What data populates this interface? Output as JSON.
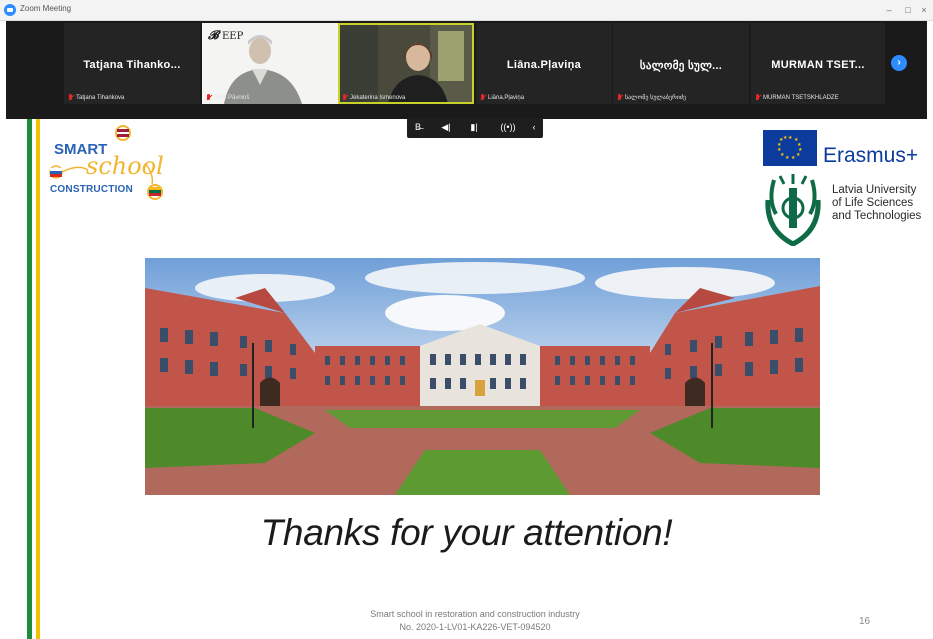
{
  "window": {
    "title": "Zoom Meeting",
    "controls": {
      "minimize": "–",
      "maximize": "□",
      "close": "×"
    }
  },
  "gallery": {
    "tiles": [
      {
        "display_name": "Tatjana Tihanko...",
        "label": "Tatjana Tihankova",
        "has_video": false
      },
      {
        "display_name": "",
        "label": "Ilmis Pāvniņš",
        "has_video": true,
        "overlay_text": "EEP"
      },
      {
        "display_name": "",
        "label": "Jekaterina Ismenova",
        "has_video": true,
        "active_speaker": true
      },
      {
        "display_name": "Liāna.Pļaviņa",
        "label": "Liāna.Pļaviņa",
        "has_video": false
      },
      {
        "display_name": "სალომე სულ...",
        "label": "სალომე სულაბერიძე",
        "has_video": false
      },
      {
        "display_name": "MURMAN TSET...",
        "label": "MURMAN TSETSKHLADZE",
        "has_video": false
      }
    ],
    "next_icon": "chevron-right-icon"
  },
  "toolbar": {
    "items": [
      {
        "icon": "annotate-icon",
        "glyph": "B͍"
      },
      {
        "icon": "volume-icon",
        "glyph": "◀︎"
      },
      {
        "icon": "microphone-icon",
        "glyph": "🎙"
      },
      {
        "icon": "broadcast-icon",
        "glyph": "((•))"
      },
      {
        "icon": "collapse-icon",
        "glyph": "‹"
      }
    ]
  },
  "slide": {
    "logo_left": {
      "line1": "SMART",
      "line2": "school",
      "line3": "CONSTRUCTION"
    },
    "erasmus_label": "Erasmus+",
    "university": {
      "line1": "Latvia University",
      "line2": "of Life Sciences",
      "line3": "and Technologies"
    },
    "thanks": "Thanks for your attention!",
    "footer": {
      "line1": "Smart school in restoration and construction industry",
      "line2": "No. 2020-1-LV01-KA226-VET-094520"
    },
    "page_number": "16",
    "colors": {
      "stripe_green": "#1e8a3b",
      "stripe_yellow": "#f2c100",
      "eu_blue": "#0b3b9c",
      "brick": "#c2554a"
    }
  }
}
